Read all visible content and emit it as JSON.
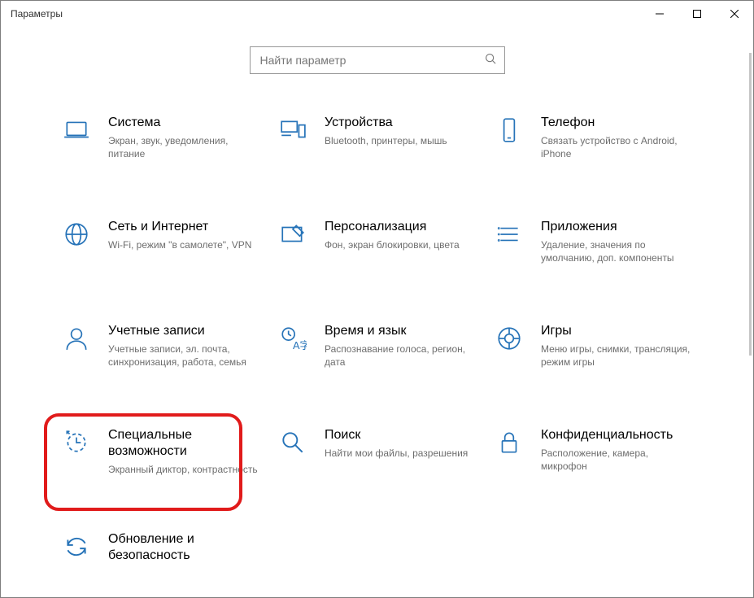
{
  "window": {
    "title": "Параметры"
  },
  "search": {
    "placeholder": "Найти параметр"
  },
  "categories": [
    {
      "id": "system",
      "title": "Система",
      "desc": "Экран, звук, уведомления, питание"
    },
    {
      "id": "devices",
      "title": "Устройства",
      "desc": "Bluetooth, принтеры, мышь"
    },
    {
      "id": "phone",
      "title": "Телефон",
      "desc": "Связать устройство с Android, iPhone"
    },
    {
      "id": "network",
      "title": "Сеть и Интернет",
      "desc": "Wi-Fi, режим \"в самолете\", VPN"
    },
    {
      "id": "personalization",
      "title": "Персонализация",
      "desc": "Фон, экран блокировки, цвета"
    },
    {
      "id": "apps",
      "title": "Приложения",
      "desc": "Удаление, значения по умолчанию, доп. компоненты"
    },
    {
      "id": "accounts",
      "title": "Учетные записи",
      "desc": "Учетные записи, эл. почта, синхронизация, работа, семья"
    },
    {
      "id": "timelang",
      "title": "Время и язык",
      "desc": "Распознавание голоса, регион, дата"
    },
    {
      "id": "gaming",
      "title": "Игры",
      "desc": "Меню игры, снимки, трансляция, режим игры"
    },
    {
      "id": "ease",
      "title": "Специальные возможности",
      "desc": "Экранный диктор, контрастность"
    },
    {
      "id": "search",
      "title": "Поиск",
      "desc": "Найти мои файлы, разрешения"
    },
    {
      "id": "privacy",
      "title": "Конфиденциальность",
      "desc": "Расположение, камера, микрофон"
    },
    {
      "id": "update",
      "title": "Обновление и безопасность",
      "desc": ""
    }
  ]
}
